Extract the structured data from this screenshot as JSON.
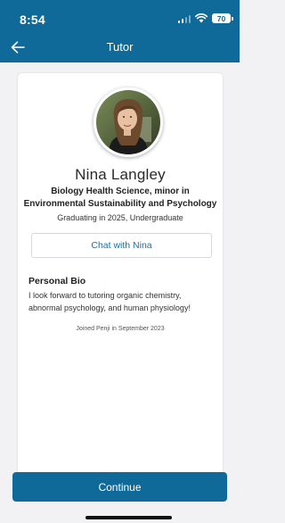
{
  "status_bar": {
    "time": "8:54",
    "battery": "70"
  },
  "header": {
    "title": "Tutor",
    "back_icon": "arrow-left-icon"
  },
  "profile": {
    "name": "Nina Langley",
    "major": "Biology Health Science, minor in Environmental Sustainability and Psychology",
    "graduation": "Graduating in 2025, Undergraduate",
    "chat_button_label": "Chat with Nina",
    "bio_heading": "Personal Bio",
    "bio_text": "I look forward to tutoring organic chemistry, abnormal psychology, and human physiology!",
    "joined": "Joined Penji in September 2023"
  },
  "footer": {
    "continue_label": "Continue"
  },
  "colors": {
    "primary": "#0f6a99",
    "link": "#1a70a8",
    "background": "#f2f2f4"
  }
}
